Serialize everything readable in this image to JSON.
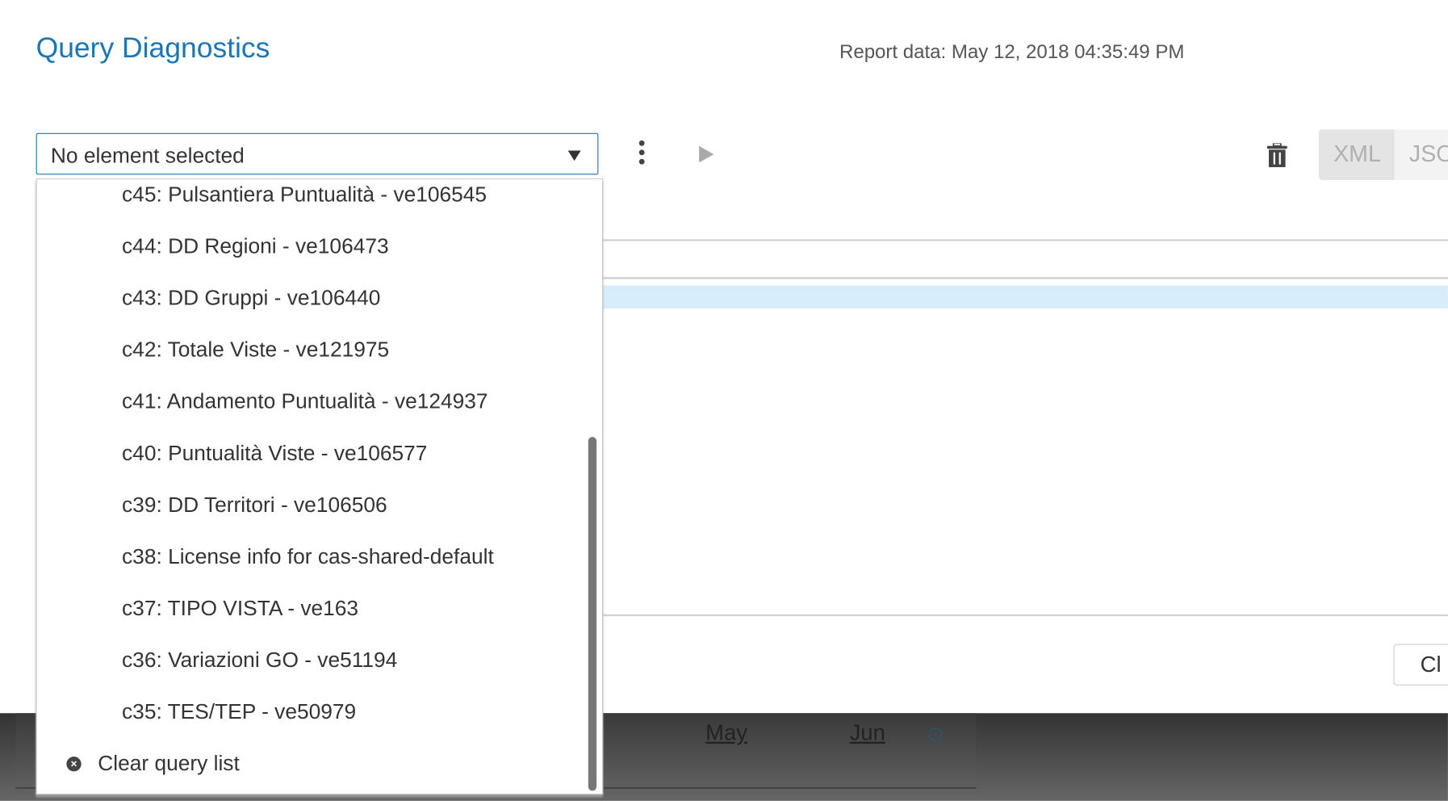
{
  "header": {
    "title": "Query Diagnostics",
    "report_data": "Report data: May 12, 2018 04:35:49 PM"
  },
  "toolbar": {
    "select_value": "No element selected",
    "xml_label": "XML",
    "json_label": "JSO",
    "close_label": "Cl"
  },
  "dropdown": {
    "items": [
      "c45: Pulsantiera Puntualità - ve106545",
      "c44: DD Regioni - ve106473",
      "c43: DD Gruppi - ve106440",
      "c42: Totale Viste - ve121975",
      "c41: Andamento Puntualità - ve124937",
      "c40: Puntualità Viste - ve106577",
      "c39: DD Territori - ve106506",
      "c38: License info for cas-shared-default",
      "c37: TIPO VISTA - ve163",
      "c36: Variazioni GO - ve51194",
      "c35: TES/TEP - ve50979"
    ],
    "clear_label": "Clear query list"
  },
  "background": {
    "months": [
      "May",
      "Jun"
    ],
    "info_icon": "i"
  },
  "colors": {
    "accent": "#1b76b6",
    "selected_row": "#d7edfc"
  }
}
